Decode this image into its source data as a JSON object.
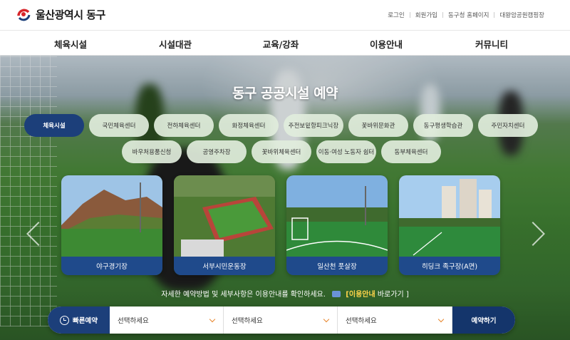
{
  "header": {
    "logo_text": "울산광역시 동구",
    "util_links": [
      "로그인",
      "회원가입",
      "동구청 홈페이지",
      "대왕암공원캠핑장"
    ]
  },
  "gnb": [
    "체육시설",
    "시설대관",
    "교육/강좌",
    "이용안내",
    "커뮤니티"
  ],
  "hero": {
    "title": "동구 공공시설 예약",
    "categories_row1": [
      "체육시설",
      "국민체육센터",
      "전하체육센터",
      "화정체육센터",
      "주전보밑항피크닉장",
      "꽃바위문화관",
      "동구평생학습관",
      "주민자치센터"
    ],
    "categories_row2": [
      "바우처용품신청",
      "공영주차장",
      "꽃바위체육센터",
      "이동·여성 노동자 쉼터",
      "동부체육센터"
    ],
    "active_category": "체육시설",
    "cards": [
      {
        "label": "야구경기장"
      },
      {
        "label": "서부시민운동장"
      },
      {
        "label": "일산천 풋살장"
      },
      {
        "label": "히딩크 족구장(A면)"
      }
    ],
    "notice_text": "자세한 예약방법 및 세부사항은 이용안내를 확인하세요.",
    "notice_link": "[이용안내",
    "notice_link_suffix": "바로가기 ]"
  },
  "quick": {
    "label": "빠른예약",
    "selects": [
      "선택하세요",
      "선택하세요",
      "선택하세요"
    ],
    "submit": "예약하기"
  },
  "colors": {
    "primary": "#1c3f7a",
    "accent": "#e8862c",
    "logo_red": "#d7262b"
  }
}
